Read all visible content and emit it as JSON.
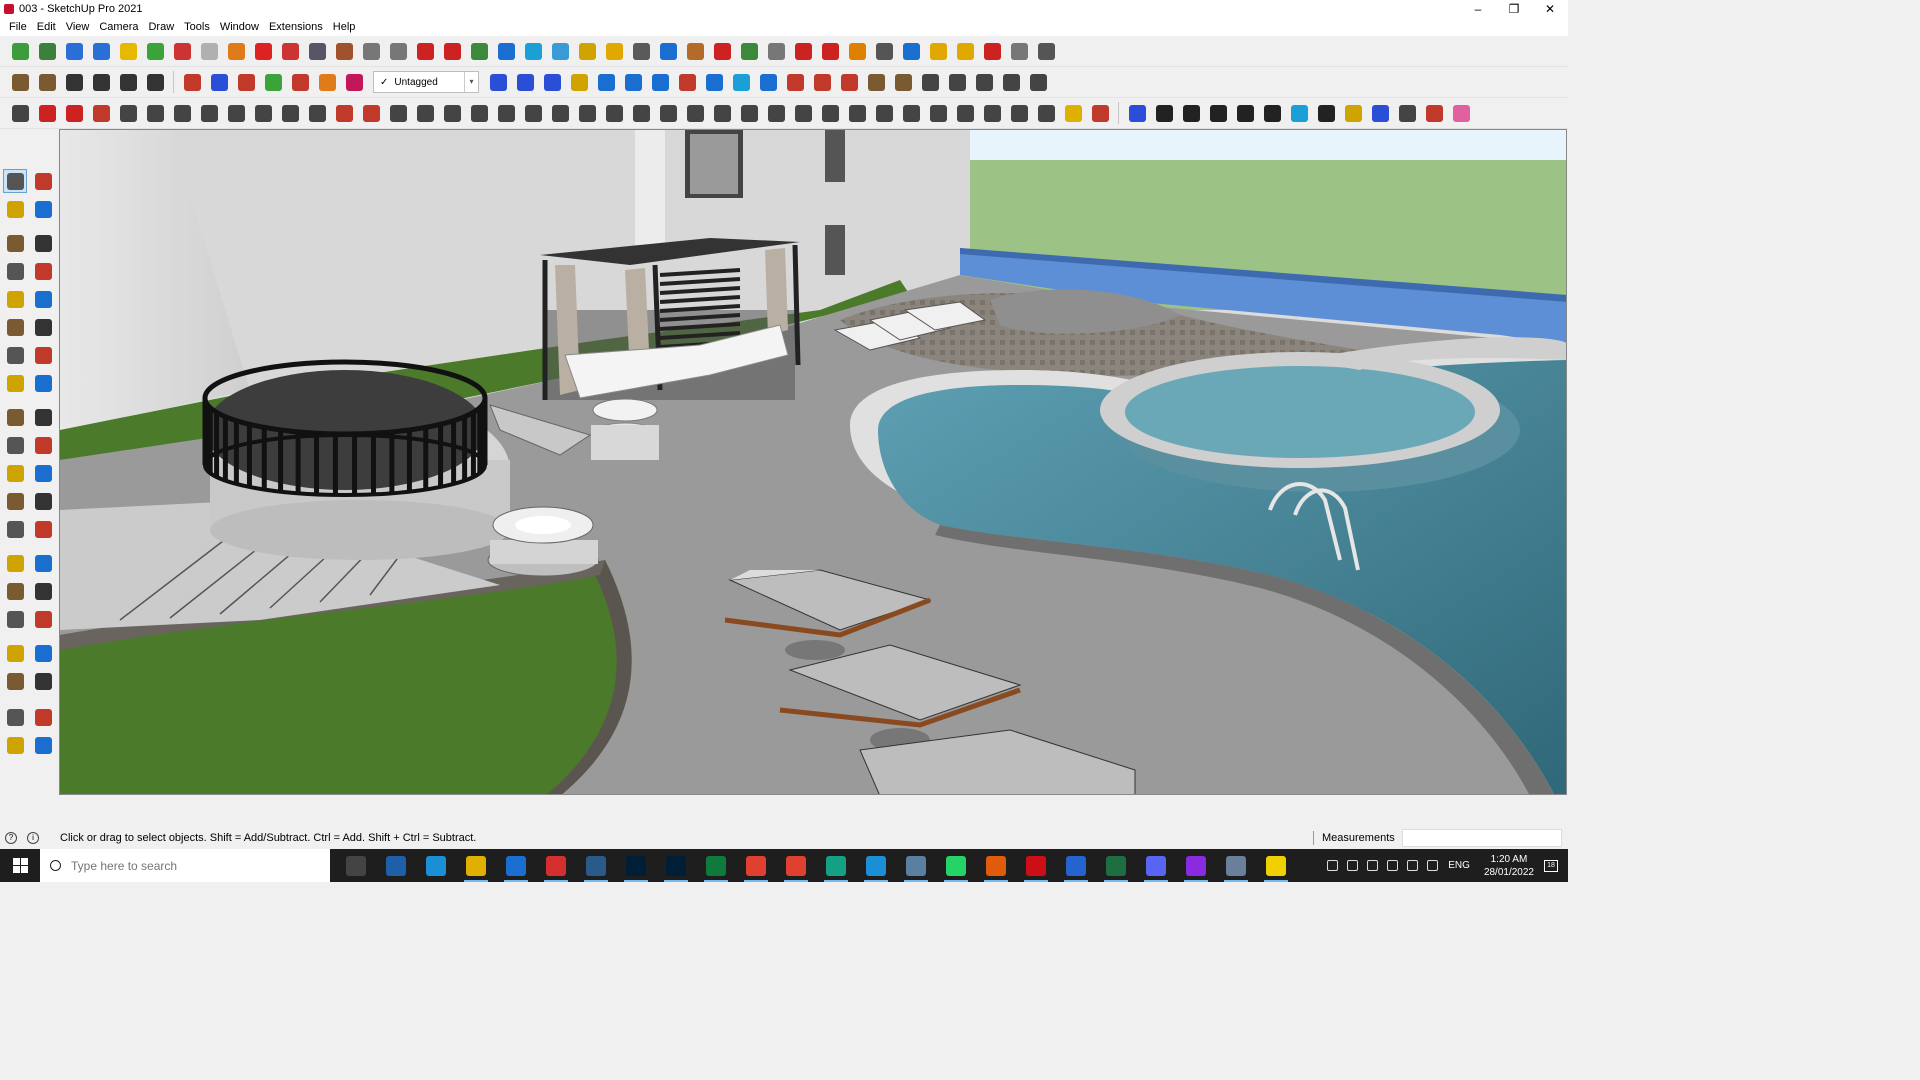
{
  "window": {
    "title": "003 - SketchUp Pro 2021",
    "controls": [
      "–",
      "❐",
      "✕"
    ]
  },
  "menu": [
    "File",
    "Edit",
    "View",
    "Camera",
    "Draw",
    "Tools",
    "Window",
    "Extensions",
    "Help"
  ],
  "tag_selector": {
    "check": "✓",
    "value": "Untagged",
    "caret": "▾"
  },
  "status": {
    "message": "Click or drag to select objects. Shift = Add/Subtract. Ctrl = Add. Shift + Ctrl = Subtract.",
    "measurements_label": "Measurements",
    "measurements_value": ""
  },
  "taskbar": {
    "search_placeholder": "Type here to search",
    "language": "ENG",
    "time": "1:20 AM",
    "date": "28/01/2022",
    "notification_count": "18"
  },
  "colors": {
    "accent": "#c8102e",
    "grass": "#4b7a2a",
    "pool_water": "#3c7a90",
    "deck": "#9a9a9a",
    "sky": "#9cc285"
  },
  "icons": {
    "toolbar_row1": [
      "#3d9d3d",
      "#3d7f3d",
      "#2a6fd6",
      "#2a6fd6",
      "#e6b800",
      "#3aa43a",
      "#cc3333",
      "#b0b0b0",
      "#e07b1a",
      "#dd2222",
      "#cc3333",
      "#556",
      "#a0522d",
      "#777",
      "#777",
      "#cc2222",
      "#cc2222",
      "#3b8a3b",
      "#1a6ecf",
      "#1a9fd6",
      "#3a9ad6",
      "#d0a400",
      "#e0a800",
      "#5a5a5a",
      "#1a6ecf",
      "#b46a28",
      "#cc2222",
      "#3b8a3b",
      "#777",
      "#cc2222",
      "#cc2222",
      "#e08000",
      "#555",
      "#1a6ecf",
      "#e0a800",
      "#e0a800",
      "#cc2222",
      "#777",
      "#555"
    ],
    "toolbar_row2_left": [
      "#7a5a30",
      "#7a5a30",
      "#333",
      "#333",
      "#333",
      "#333"
    ],
    "toolbar_row2_mid": [
      "#c0392b",
      "#2a4fd6",
      "#c0392b",
      "#3aa43a",
      "#c0392b",
      "#e07b1a",
      "#c2185b"
    ],
    "toolbar_row2_right": [
      "#2a4fd6",
      "#2a4fd6",
      "#2a4fd6",
      "#d0a400",
      "#1a6ecf",
      "#1a6ecf",
      "#1a6ecf",
      "#c0392b",
      "#1a6ecf",
      "#1a9fd6",
      "#1a6ecf",
      "#c0392b",
      "#c0392b",
      "#c0392b",
      "#7a5a30",
      "#7a5a30",
      "#444",
      "#444",
      "#444",
      "#444",
      "#444"
    ],
    "toolbar_row3": [
      "#444",
      "#cc2222",
      "#cc2222",
      "#c0392b",
      "#444",
      "#444",
      "#444",
      "#444",
      "#444",
      "#444",
      "#444",
      "#444",
      "#c0392b",
      "#c0392b",
      "#444",
      "#444",
      "#444",
      "#444",
      "#444",
      "#444",
      "#444",
      "#444",
      "#444",
      "#444",
      "#444",
      "#444",
      "#444",
      "#444",
      "#444",
      "#444",
      "#444",
      "#444",
      "#444",
      "#444",
      "#444",
      "#444",
      "#444",
      "#444",
      "#444",
      "#e0b000",
      "#c0392b"
    ],
    "toolbar_row3_right": [
      "#2a4fd6",
      "#222",
      "#222",
      "#222",
      "#222",
      "#222",
      "#1a9fd6",
      "#222",
      "#d0a400",
      "#2a4fd6",
      "#444",
      "#c0392b",
      "#e060a0"
    ],
    "taskbar_apps": [
      "task-view-icon",
      "calculator-icon",
      "edge-icon",
      "file-explorer-icon",
      "sketchup-icon",
      "acrobat-icon",
      "snipping-icon",
      "photoshop-icon",
      "photoshop-icon",
      "vscode-alt-icon",
      "chrome-icon",
      "chrome-icon",
      "terminal-icon",
      "app-3-icon",
      "notes-icon",
      "whatsapp-icon",
      "grammarly-icon",
      "opera-icon",
      "todo-icon",
      "excel-icon",
      "discord-icon",
      "podcast-icon",
      "explorer-icon",
      "sticky-notes-icon"
    ]
  },
  "left_tools": [
    "select-icon",
    "component-icon",
    "paint-bucket-icon",
    "eraser-icon",
    "line-icon",
    "freehand-icon",
    "rectangle-icon",
    "rotated-rectangle-icon",
    "circle-icon",
    "polygon-icon",
    "arc-icon",
    "two-point-arc-icon",
    "three-point-arc-icon",
    "pie-icon",
    "move-icon",
    "push-pull-icon",
    "rotate-icon",
    "follow-me-icon",
    "scale-icon",
    "offset-icon",
    "tape-measure-icon",
    "dimension-icon",
    "protractor-icon",
    "text-icon",
    "axes-icon",
    "3d-text-icon",
    "orbit-icon",
    "pan-icon",
    "zoom-icon",
    "zoom-window-icon",
    "zoom-extents-icon",
    "previous-view-icon",
    "position-camera-icon",
    "look-around-icon",
    "walk-icon",
    "section-plane-icon",
    "sandbox-icon",
    "sandbox-2-icon",
    "sandbox-3-icon",
    "sandbox-4-icon"
  ]
}
